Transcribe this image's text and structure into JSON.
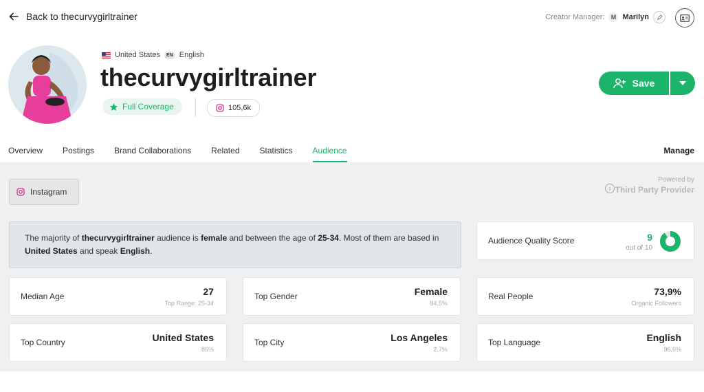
{
  "header": {
    "back_label": "Back to thecurvygirltrainer",
    "creator_manager_label": "Creator Manager:",
    "manager_initial": "M",
    "manager_name": "Marilyn"
  },
  "profile": {
    "country": "United States",
    "language_code": "EN",
    "language": "English",
    "handle": "thecurvygirltrainer",
    "coverage": "Full Coverage",
    "followers": "105,6k",
    "save_label": "Save"
  },
  "tabs": [
    {
      "label": "Overview",
      "active": false
    },
    {
      "label": "Postings",
      "active": false
    },
    {
      "label": "Brand Collaborations",
      "active": false
    },
    {
      "label": "Related",
      "active": false
    },
    {
      "label": "Statistics",
      "active": false
    },
    {
      "label": "Audience",
      "active": true
    }
  ],
  "manage_label": "Manage",
  "audience": {
    "platform": "Instagram",
    "powered_by": "Powered by",
    "provider": "Third Party Provider",
    "summary": {
      "p1": "The majority of ",
      "handle": "thecurvygirltrainer",
      "p2": " audience is ",
      "gender": "female",
      "p3": " and between the age of ",
      "age": "25-34",
      "p4": ". Most of them are based in ",
      "country": "United States",
      "p5": " and speak ",
      "language": "English",
      "p6": "."
    },
    "quality": {
      "label": "Audience Quality Score",
      "value": "9",
      "sub": "out of 10",
      "score": 9,
      "max": 10
    },
    "cards": {
      "median_age": {
        "label": "Median Age",
        "value": "27",
        "sub": "Top Range: 25-34"
      },
      "top_gender": {
        "label": "Top Gender",
        "value": "Female",
        "sub": "94,5%"
      },
      "real_people": {
        "label": "Real People",
        "value": "73,9%",
        "sub": "Organic Followers"
      },
      "top_country": {
        "label": "Top Country",
        "value": "United States",
        "sub": "86%"
      },
      "top_city": {
        "label": "Top City",
        "value": "Los Angeles",
        "sub": "2,7%"
      },
      "top_language": {
        "label": "Top Language",
        "value": "English",
        "sub": "96,6%"
      }
    }
  },
  "colors": {
    "accent": "#1cb36b",
    "instagram": "#d6338a"
  }
}
